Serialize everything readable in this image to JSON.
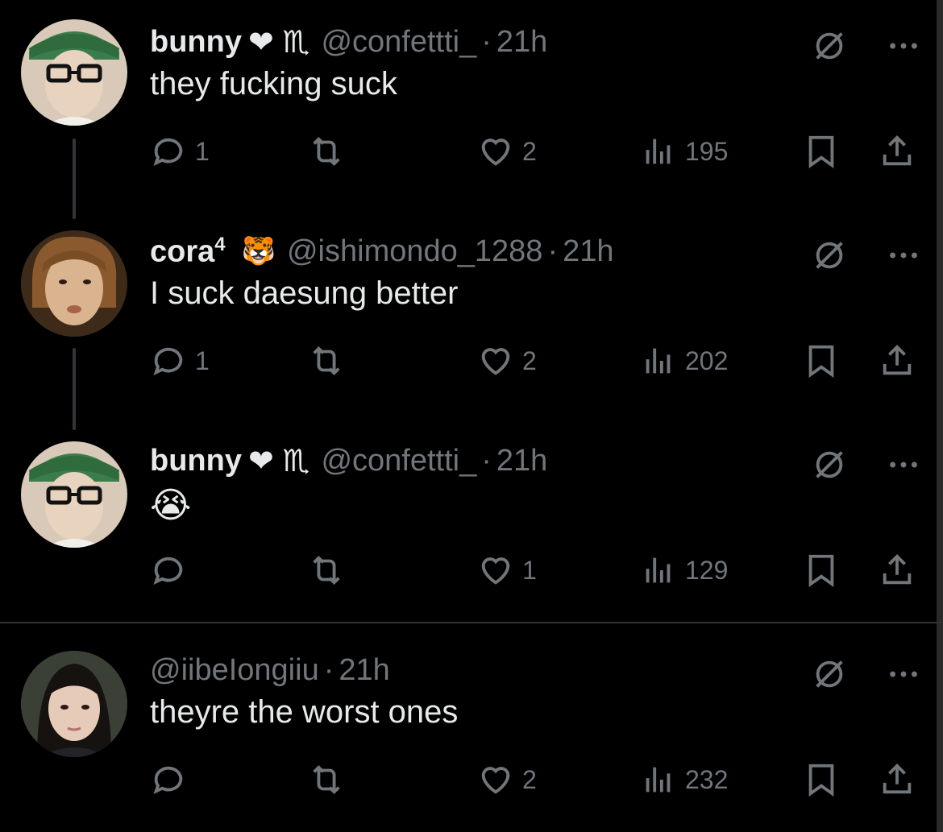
{
  "tweets": [
    {
      "name": "bunny",
      "name_suffix": "❤ ♏",
      "handle": "@confettti_",
      "time": "21h",
      "text": "they fucking suck",
      "replies": "1",
      "retweets": "",
      "likes": "2",
      "views": "195"
    },
    {
      "name": "cora",
      "name_sup": "4",
      "name_suffix": "🐯",
      "handle": "@ishimondo_1288",
      "time": "21h",
      "text": "I suck daesung better",
      "replies": "1",
      "retweets": "",
      "likes": "2",
      "views": "202"
    },
    {
      "name": "bunny",
      "name_suffix": "❤ ♏",
      "handle": "@confettti_",
      "time": "21h",
      "text": "😭",
      "replies": "",
      "retweets": "",
      "likes": "1",
      "views": "129"
    },
    {
      "name": "",
      "handle": "@iibeIongiiu",
      "time": "21h",
      "text": "theyre the worst ones",
      "replies": "",
      "retweets": "",
      "likes": "2",
      "views": "232"
    }
  ],
  "separator_dot": "·",
  "colors": {
    "background": "#000000",
    "text": "#e7e9ea",
    "muted": "#71767b",
    "divider": "#2f3336"
  }
}
